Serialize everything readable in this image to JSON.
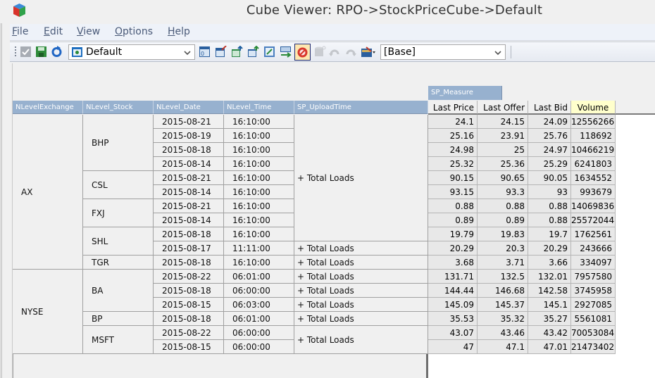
{
  "window": {
    "title": "Cube Viewer: RPO->StockPriceCube->Default",
    "app_icon": "cube-icon"
  },
  "menu": [
    {
      "label": "File",
      "mnemonic": "F",
      "rest": "ile"
    },
    {
      "label": "Edit",
      "mnemonic": "E",
      "rest": "dit"
    },
    {
      "label": "View",
      "mnemonic": "V",
      "rest": "iew"
    },
    {
      "label": "Options",
      "mnemonic": "O",
      "rest": "ptions"
    },
    {
      "label": "Help",
      "mnemonic": "H",
      "rest": "elp"
    }
  ],
  "toolbar": {
    "left_icons": [
      "commit-check-icon",
      "save-icon",
      "refresh-icon"
    ],
    "view_select": {
      "value": "Default",
      "icon": "view-icon"
    },
    "right_icons": [
      "recalculate-icon",
      "auto-recalculate-icon",
      "export-excel-icon",
      "export-slice-icon",
      "zero-suppress-icon",
      "move-rows-icon",
      "suppress-zeros-toggle-icon",
      "sandbox-icon",
      "undo-icon",
      "redo-icon",
      "sandbox-menu-icon"
    ],
    "sandbox_select": {
      "value": "[Base]"
    }
  },
  "grid": {
    "column_dimension_label": "SP_Measure",
    "row_headers": [
      "NLevelExchange",
      "NLevel_Stock",
      "NLevel_Date",
      "NLevel_Time",
      "SP_UploadTime"
    ],
    "measure_headers": [
      "Last Price",
      "Last Offer",
      "Last Bid",
      "Volume"
    ],
    "exchanges": [
      {
        "name": "AX",
        "rows": 11
      },
      {
        "name": "NYSE",
        "rows": 6
      }
    ],
    "stocks": [
      {
        "name": "BHP",
        "rows": 4
      },
      {
        "name": "CSL",
        "rows": 2
      },
      {
        "name": "FXJ",
        "rows": 2
      },
      {
        "name": "SHL",
        "rows": 2
      },
      {
        "name": "TGR",
        "rows": 1
      },
      {
        "name": "BA",
        "rows": 3
      },
      {
        "name": "BP",
        "rows": 1
      },
      {
        "name": "MSFT",
        "rows": 2
      }
    ],
    "upload_groups": [
      {
        "label": "+ Total Loads",
        "rows": 9
      },
      {
        "label": "+ Total Loads",
        "rows": 1
      },
      {
        "label": "+ Total Loads",
        "rows": 1
      },
      {
        "label": "+ Total Loads",
        "rows": 1
      },
      {
        "label": "+ Total Loads",
        "rows": 1
      },
      {
        "label": "+ Total Loads",
        "rows": 1
      },
      {
        "label": "+ Total Loads",
        "rows": 1
      },
      {
        "label": "+ Total Loads",
        "rows": 2
      }
    ],
    "rows": [
      {
        "date": "2015-08-21",
        "time": "16:10:00",
        "values": [
          "24.1",
          "24.15",
          "24.09",
          "12556266"
        ]
      },
      {
        "date": "2015-08-19",
        "time": "16:10:00",
        "values": [
          "25.16",
          "23.91",
          "25.76",
          "118692"
        ]
      },
      {
        "date": "2015-08-18",
        "time": "16:10:00",
        "values": [
          "24.98",
          "25",
          "24.97",
          "10466219"
        ]
      },
      {
        "date": "2015-08-14",
        "time": "16:10:00",
        "values": [
          "25.32",
          "25.36",
          "25.29",
          "6241803"
        ]
      },
      {
        "date": "2015-08-21",
        "time": "16:10:00",
        "values": [
          "90.15",
          "90.65",
          "90.05",
          "1634552"
        ]
      },
      {
        "date": "2015-08-14",
        "time": "16:10:00",
        "values": [
          "93.15",
          "93.3",
          "93",
          "993679"
        ]
      },
      {
        "date": "2015-08-21",
        "time": "16:10:00",
        "values": [
          "0.88",
          "0.88",
          "0.88",
          "14069836"
        ]
      },
      {
        "date": "2015-08-14",
        "time": "16:10:00",
        "values": [
          "0.89",
          "0.89",
          "0.88",
          "25572044"
        ]
      },
      {
        "date": "2015-08-18",
        "time": "16:10:00",
        "values": [
          "19.79",
          "19.83",
          "19.7",
          "1762561"
        ]
      },
      {
        "date": "2015-08-17",
        "time": "11:11:00",
        "values": [
          "20.29",
          "20.3",
          "20.29",
          "243666"
        ]
      },
      {
        "date": "2015-08-18",
        "time": "16:10:00",
        "values": [
          "3.68",
          "3.71",
          "3.66",
          "334097"
        ]
      },
      {
        "date": "2015-08-22",
        "time": "06:01:00",
        "values": [
          "131.71",
          "132.5",
          "132.01",
          "7957580"
        ]
      },
      {
        "date": "2015-08-18",
        "time": "06:00:00",
        "values": [
          "144.44",
          "146.68",
          "142.58",
          "3745958"
        ]
      },
      {
        "date": "2015-08-15",
        "time": "06:03:00",
        "values": [
          "145.09",
          "145.37",
          "145.1",
          "2927085"
        ]
      },
      {
        "date": "2015-08-18",
        "time": "06:01:00",
        "values": [
          "35.53",
          "35.32",
          "35.27",
          "5561081"
        ]
      },
      {
        "date": "2015-08-22",
        "time": "06:00:00",
        "values": [
          "43.07",
          "43.46",
          "43.42",
          "70053084"
        ]
      },
      {
        "date": "2015-08-15",
        "time": "06:00:00",
        "values": [
          "47",
          "47.1",
          "47.01",
          "21473402"
        ]
      }
    ]
  },
  "colors": {
    "header_blue": "#97b1cf",
    "volume_highlight": "#ffffcc",
    "cell_gray": "#e8e8e8"
  }
}
